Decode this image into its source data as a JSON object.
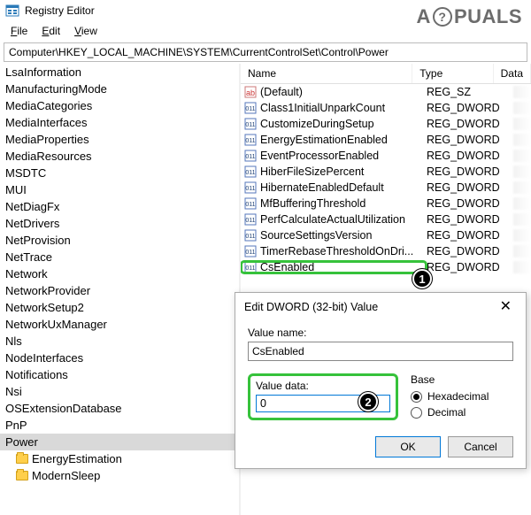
{
  "watermark": {
    "left": "A",
    "right": "PUALS"
  },
  "window": {
    "title": "Registry Editor"
  },
  "menu": {
    "file": "File",
    "edit": "Edit",
    "view": "View"
  },
  "address": {
    "path": "Computer\\HKEY_LOCAL_MACHINE\\SYSTEM\\CurrentControlSet\\Control\\Power"
  },
  "tree": {
    "items": [
      "LsaInformation",
      "ManufacturingMode",
      "MediaCategories",
      "MediaInterfaces",
      "MediaProperties",
      "MediaResources",
      "MSDTC",
      "MUI",
      "NetDiagFx",
      "NetDrivers",
      "NetProvision",
      "NetTrace",
      "Network",
      "NetworkProvider",
      "NetworkSetup2",
      "NetworkUxManager",
      "Nls",
      "NodeInterfaces",
      "Notifications",
      "Nsi",
      "OSExtensionDatabase",
      "PnP"
    ],
    "selected": "Power",
    "children": [
      "EnergyEstimation",
      "ModernSleep"
    ]
  },
  "list": {
    "headers": {
      "name": "Name",
      "type": "Type",
      "data": "Data"
    },
    "rows": [
      {
        "name": "(Default)",
        "type": "REG_SZ",
        "icon": "sz"
      },
      {
        "name": "Class1InitialUnparkCount",
        "type": "REG_DWORD",
        "icon": "dw"
      },
      {
        "name": "CustomizeDuringSetup",
        "type": "REG_DWORD",
        "icon": "dw"
      },
      {
        "name": "EnergyEstimationEnabled",
        "type": "REG_DWORD",
        "icon": "dw"
      },
      {
        "name": "EventProcessorEnabled",
        "type": "REG_DWORD",
        "icon": "dw"
      },
      {
        "name": "HiberFileSizePercent",
        "type": "REG_DWORD",
        "icon": "dw"
      },
      {
        "name": "HibernateEnabledDefault",
        "type": "REG_DWORD",
        "icon": "dw"
      },
      {
        "name": "MfBufferingThreshold",
        "type": "REG_DWORD",
        "icon": "dw"
      },
      {
        "name": "PerfCalculateActualUtilization",
        "type": "REG_DWORD",
        "icon": "dw"
      },
      {
        "name": "SourceSettingsVersion",
        "type": "REG_DWORD",
        "icon": "dw"
      },
      {
        "name": "TimerRebaseThresholdOnDri...",
        "type": "REG_DWORD",
        "icon": "dw"
      },
      {
        "name": "CsEnabled",
        "type": "REG_DWORD",
        "icon": "dw",
        "highlight": true
      }
    ]
  },
  "callouts": {
    "one": "1",
    "two": "2"
  },
  "dialog": {
    "title": "Edit DWORD (32-bit) Value",
    "value_name_label": "Value name:",
    "value_name": "CsEnabled",
    "value_data_label": "Value data:",
    "value_data": "0",
    "base_label": "Base",
    "hex": "Hexadecimal",
    "dec": "Decimal",
    "ok": "OK",
    "cancel": "Cancel"
  }
}
